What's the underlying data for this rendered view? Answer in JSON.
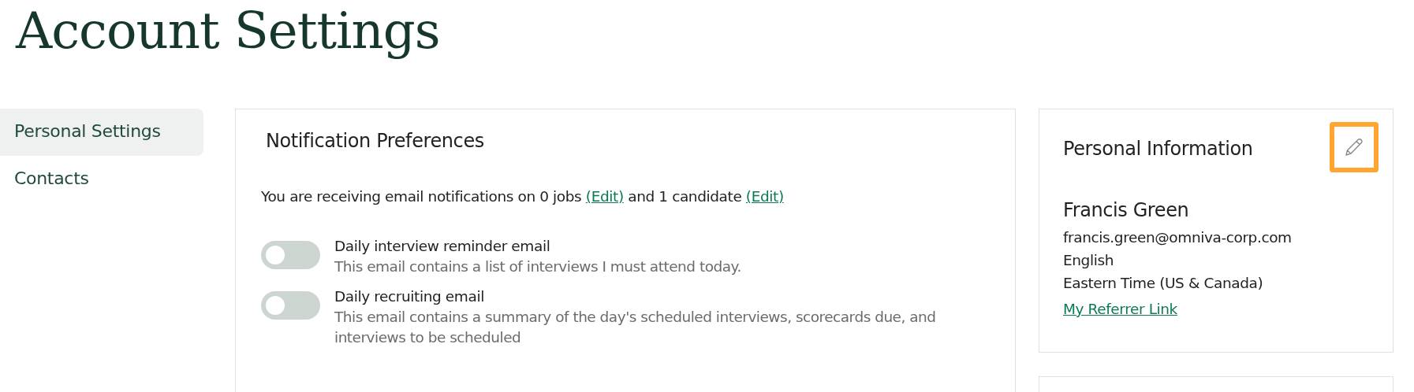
{
  "page_title": "Account Settings",
  "sidebar": {
    "items": [
      {
        "label": "Personal Settings",
        "selected": true
      },
      {
        "label": "Contacts",
        "selected": false
      }
    ]
  },
  "notification_preferences": {
    "title": "Notification Preferences",
    "summary": [
      {
        "kind": "text",
        "text": "You are receiving email notifications on 0 jobs"
      },
      {
        "kind": "link",
        "text": "(Edit)"
      },
      {
        "kind": "text",
        "text": "and 1 candidate"
      },
      {
        "kind": "link",
        "text": "(Edit)"
      }
    ],
    "options": [
      {
        "label": "Daily interview reminder email",
        "description": "This email contains a list of interviews I must attend today.",
        "on": false
      },
      {
        "label": "Daily recruiting email",
        "description": "This email contains a summary of the day's scheduled interviews, scorecards due, and interviews to be scheduled",
        "on": false
      }
    ]
  },
  "personal_information": {
    "title": "Personal Information",
    "edit_highlighted": true,
    "name": "Francis Green",
    "details": [
      "francis.green@omniva-corp.com",
      "English",
      "Eastern Time (US & Canada)"
    ],
    "link": "My Referrer Link"
  }
}
